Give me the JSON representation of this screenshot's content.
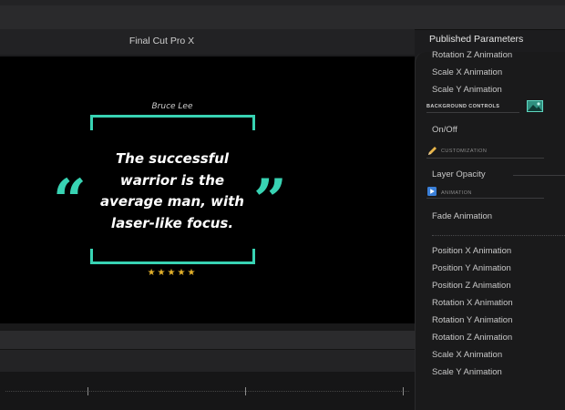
{
  "app": {
    "title": "Final Cut Pro X"
  },
  "viewer": {
    "quote": {
      "author": "Bruce Lee",
      "text": "The successful warrior is the average man, with laser-like focus.",
      "open_mark": "“",
      "close_mark": "”",
      "rating": 5,
      "stars": "★★★★★"
    },
    "accent_color": "#38d3b3",
    "star_color": "#e3b12b"
  },
  "panel": {
    "title": "Published Parameters",
    "top_items": [
      "Rotation Z Animation",
      "Scale X Animation",
      "Scale Y Animation"
    ],
    "background_controls": {
      "label": "BACKGROUND CONTROLS",
      "icon": "image-icon"
    },
    "on_off": "On/Off",
    "customization": {
      "label": "CUSTOMIZATION",
      "icon": "pencil-icon"
    },
    "layer_opacity": "Layer Opacity",
    "animation": {
      "label": "ANIMATION",
      "icon": "play-icon"
    },
    "fade_animation": "Fade Animation",
    "animation_items": [
      "Position X Animation",
      "Position Y Animation",
      "Position Z Animation",
      "Rotation X Animation",
      "Rotation Y Animation",
      "Rotation Z Animation",
      "Scale X Animation",
      "Scale Y Animation"
    ]
  }
}
